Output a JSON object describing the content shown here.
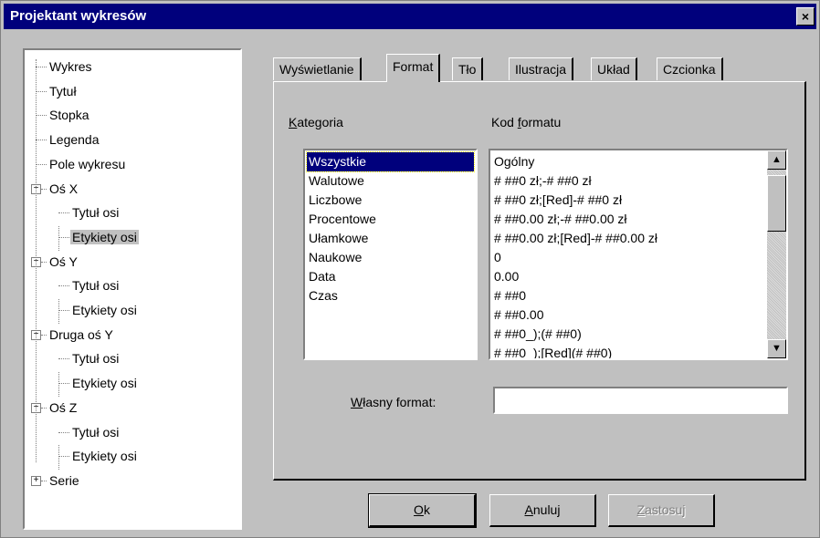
{
  "window": {
    "title": "Projektant wykresów",
    "close_label": "×"
  },
  "tree": {
    "items": [
      {
        "label": "Wykres"
      },
      {
        "label": "Tytuł"
      },
      {
        "label": "Stopka"
      },
      {
        "label": "Legenda"
      },
      {
        "label": "Pole wykresu"
      },
      {
        "label": "Oś X",
        "expander": "−"
      },
      {
        "label": "Tytuł osi"
      },
      {
        "label": "Etykiety osi",
        "selected": true
      },
      {
        "label": "Oś Y",
        "expander": "−"
      },
      {
        "label": "Tytuł osi"
      },
      {
        "label": "Etykiety osi"
      },
      {
        "label": "Druga oś Y",
        "expander": "−"
      },
      {
        "label": "Tytuł osi"
      },
      {
        "label": "Etykiety osi"
      },
      {
        "label": "Oś Z",
        "expander": "−"
      },
      {
        "label": "Tytuł osi"
      },
      {
        "label": "Etykiety osi"
      },
      {
        "label": "Serie",
        "expander": "+"
      }
    ]
  },
  "tabs": [
    "Wyświetlanie",
    "Format",
    "Tło",
    "Ilustracja",
    "Układ",
    "Czcionka"
  ],
  "active_tab": "Format",
  "kategoria": {
    "label_first": "K",
    "label_rest": "ategoria",
    "items": [
      "Wszystkie",
      "Walutowe",
      "Liczbowe",
      "Procentowe",
      "Ułamkowe",
      "Naukowe",
      "Data",
      "Czas"
    ],
    "selected": "Wszystkie"
  },
  "kod_formatu": {
    "label_pre": "Kod ",
    "label_u": "f",
    "label_post": "ormatu",
    "items": [
      "Ogólny",
      "# ##0 zł;-# ##0 zł",
      "# ##0 zł;[Red]-# ##0 zł",
      "# ##0.00 zł;-# ##0.00 zł",
      "# ##0.00 zł;[Red]-# ##0.00 zł",
      "0",
      "0.00",
      "# ##0",
      "# ##0.00",
      "# ##0_);(# ##0)",
      "# ##0_);[Red](# ##0)"
    ]
  },
  "wlasny_format": {
    "label_first": "W",
    "label_rest": "łasny format:",
    "value": ""
  },
  "buttons": {
    "ok": {
      "u": "O",
      "rest": "k"
    },
    "anuluj": {
      "u": "A",
      "rest": "nuluj"
    },
    "zastosuj": {
      "u": "Z",
      "rest": "astosuj"
    }
  },
  "colors": {
    "titlebar": "#00007c",
    "selection": "#00007c",
    "face": "#c0c0c0"
  }
}
